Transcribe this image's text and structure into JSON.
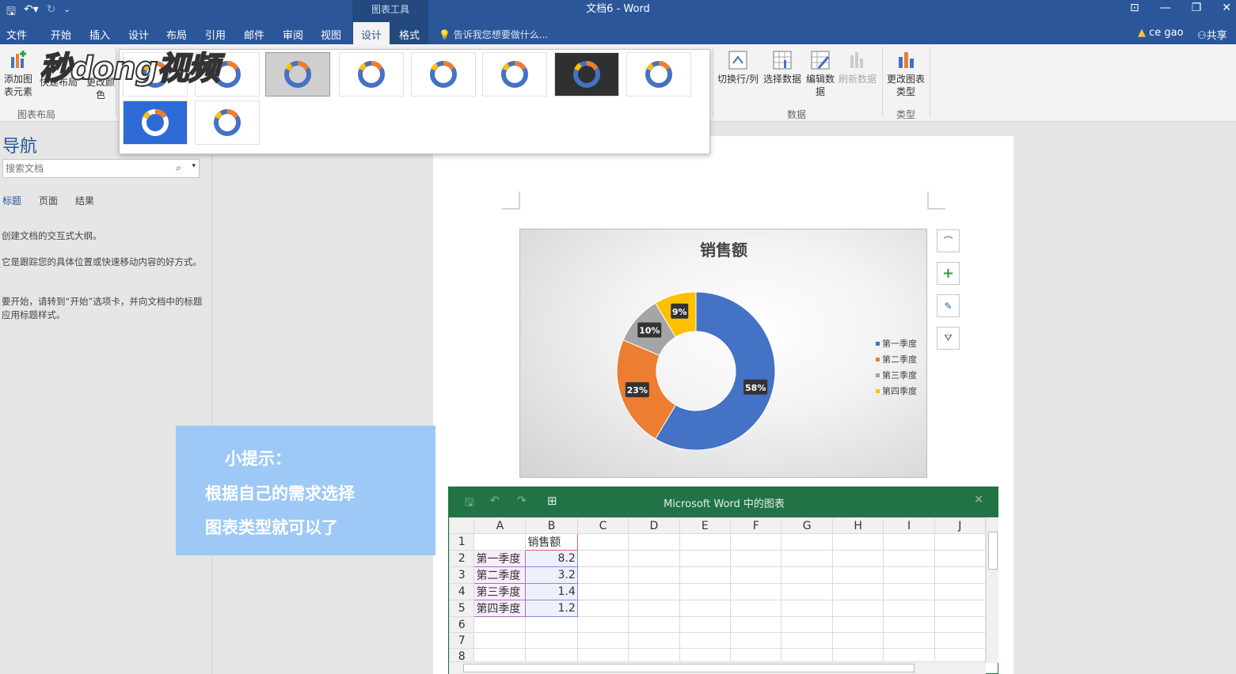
{
  "titlebar": {
    "context_tools": "图表工具",
    "document_title": "文档6 - Word"
  },
  "tabs": [
    "文件",
    "开始",
    "插入",
    "设计",
    "布局",
    "引用",
    "邮件",
    "审阅",
    "视图",
    "设计",
    "格式"
  ],
  "tell_me": "告诉我您想要做什么...",
  "user": "ce gao",
  "share": "共享",
  "ribbon": {
    "add_element": "添加图表元素",
    "quick_layout": "快速布局",
    "change_color": "更改颜色",
    "group_layout": "图表布局",
    "switch_rowcol": "切换行/列",
    "select_data": "选择数据",
    "edit_data": "编辑数据",
    "refresh_data": "刷新数据",
    "change_type": "更改图表类型",
    "group_data": "数据",
    "group_type": "类型"
  },
  "watermark": "秒dong视频",
  "nav": {
    "title": "导航",
    "search_placeholder": "搜索文档",
    "tabs": [
      "标题",
      "页面",
      "结果"
    ],
    "text1": "创建文档的交互式大纲。",
    "text2": "它是跟踪您的具体位置或快速移动内容的好方式。",
    "text3": "要开始，请转到“开始”选项卡，并向文档中的标题应用标题样式。"
  },
  "tip": {
    "line1": "小提示：",
    "line2": "根据自己的需求选择",
    "line3": "图表类型就可以了"
  },
  "chart_data": {
    "type": "pie",
    "title": "销售额",
    "categories": [
      "第一季度",
      "第二季度",
      "第三季度",
      "第四季度"
    ],
    "values": [
      8.2,
      3.2,
      1.4,
      1.2
    ],
    "data_labels": [
      "58%",
      "23%",
      "10%",
      "9%"
    ],
    "colors": [
      "#4472c4",
      "#ed7d31",
      "#a5a5a5",
      "#ffc000"
    ],
    "legend": "right"
  },
  "excel": {
    "title": "Microsoft Word 中的图表",
    "columns": [
      "A",
      "B",
      "C",
      "D",
      "E",
      "F",
      "G",
      "H",
      "I",
      "J"
    ],
    "rows": [
      [
        "1",
        "",
        "销售额"
      ],
      [
        "2",
        "第一季度",
        "8.2"
      ],
      [
        "3",
        "第二季度",
        "3.2"
      ],
      [
        "4",
        "第三季度",
        "1.4"
      ],
      [
        "5",
        "第四季度",
        "1.2"
      ],
      [
        "6",
        "",
        ""
      ],
      [
        "7",
        "",
        ""
      ],
      [
        "8",
        "",
        ""
      ]
    ]
  }
}
